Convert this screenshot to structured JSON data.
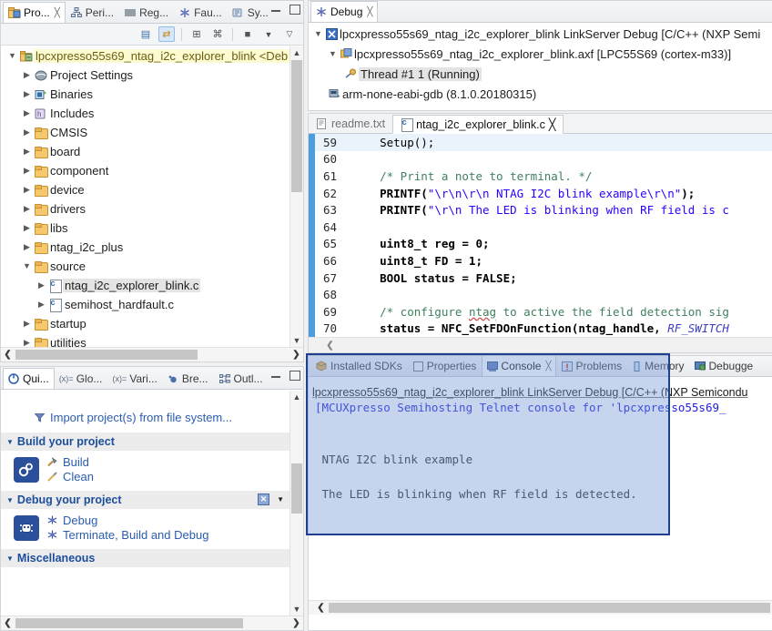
{
  "project_explorer": {
    "tabs": [
      {
        "label": "Pro...",
        "icon": "project-explorer-icon",
        "active": true,
        "closeable": true
      },
      {
        "label": "Peri...",
        "icon": "peripherals-icon",
        "active": false
      },
      {
        "label": "Reg...",
        "icon": "registers-icon",
        "active": false
      },
      {
        "label": "Fau...",
        "icon": "faults-icon",
        "active": false
      },
      {
        "label": "Sy...",
        "icon": "symbol-viewer-icon",
        "active": false
      }
    ],
    "toolbar": [
      {
        "name": "collapse-all-icon",
        "glyph": "▤",
        "selected": false
      },
      {
        "name": "link-with-editor-icon",
        "glyph": "⇄",
        "selected": true
      },
      {
        "name": "view-menu-grid-icon",
        "glyph": "⊞",
        "selected": false
      },
      {
        "name": "filters-icon",
        "glyph": "⌘",
        "selected": false
      },
      {
        "name": "focus-active-task-icon",
        "glyph": "■",
        "selected": false
      },
      {
        "name": "view-dropdown-icon",
        "glyph": "▼",
        "selected": false
      },
      {
        "name": "view-menu-icon",
        "glyph": "▽",
        "selected": false
      }
    ],
    "tree": [
      {
        "label": "lpcxpresso55s69_ntag_i2c_explorer_blink <Deb",
        "indent": 0,
        "arrow": "down",
        "icon": "project-icon",
        "highlight": "yellow"
      },
      {
        "label": "Project Settings",
        "indent": 1,
        "arrow": "right",
        "icon": "settings-icon",
        "highlight": "none"
      },
      {
        "label": "Binaries",
        "indent": 1,
        "arrow": "right",
        "icon": "binaries-icon",
        "highlight": "none"
      },
      {
        "label": "Includes",
        "indent": 1,
        "arrow": "right",
        "icon": "includes-icon",
        "highlight": "none"
      },
      {
        "label": "CMSIS",
        "indent": 1,
        "arrow": "right",
        "icon": "folder-icon",
        "highlight": "none"
      },
      {
        "label": "board",
        "indent": 1,
        "arrow": "right",
        "icon": "folder-icon",
        "highlight": "none"
      },
      {
        "label": "component",
        "indent": 1,
        "arrow": "right",
        "icon": "folder-icon",
        "highlight": "none"
      },
      {
        "label": "device",
        "indent": 1,
        "arrow": "right",
        "icon": "folder-icon",
        "highlight": "none"
      },
      {
        "label": "drivers",
        "indent": 1,
        "arrow": "right",
        "icon": "folder-icon",
        "highlight": "none"
      },
      {
        "label": "libs",
        "indent": 1,
        "arrow": "right",
        "icon": "folder-icon",
        "highlight": "none"
      },
      {
        "label": "ntag_i2c_plus",
        "indent": 1,
        "arrow": "right",
        "icon": "folder-icon",
        "highlight": "none"
      },
      {
        "label": "source",
        "indent": 1,
        "arrow": "down",
        "icon": "folder-icon",
        "highlight": "none"
      },
      {
        "label": "ntag_i2c_explorer_blink.c",
        "indent": 2,
        "arrow": "right",
        "icon": "c-file-icon",
        "highlight": "gray"
      },
      {
        "label": "semihost_hardfault.c",
        "indent": 2,
        "arrow": "right",
        "icon": "c-file-icon",
        "highlight": "none"
      },
      {
        "label": "startup",
        "indent": 1,
        "arrow": "right",
        "icon": "folder-icon",
        "highlight": "none"
      },
      {
        "label": "utilities",
        "indent": 1,
        "arrow": "right",
        "icon": "folder-icon",
        "highlight": "none"
      }
    ]
  },
  "quickstart": {
    "tabs": [
      {
        "label": "Qui...",
        "icon": "quickstart-power-icon",
        "active": true
      },
      {
        "label": "Glo...",
        "icon": "global-variables-icon",
        "active": false
      },
      {
        "label": "Vari...",
        "icon": "variables-icon",
        "active": false
      },
      {
        "label": "Bre...",
        "icon": "breakpoints-icon",
        "active": false
      },
      {
        "label": "Outl...",
        "icon": "outline-icon",
        "active": false
      }
    ],
    "import_link": "Import project(s) from file system...",
    "sections": [
      {
        "title": "Build your project",
        "icon": "build-gears-icon",
        "has_close": false,
        "items": [
          {
            "label": "Build",
            "icon": "hammer-icon"
          },
          {
            "label": "Clean",
            "icon": "brush-icon"
          }
        ]
      },
      {
        "title": "Debug your project",
        "icon": "debug-bug-icon",
        "has_close": true,
        "items": [
          {
            "label": "Debug",
            "icon": "bug-icon"
          },
          {
            "label": "Terminate, Build and Debug",
            "icon": "bug-icon"
          }
        ]
      },
      {
        "title": "Miscellaneous",
        "icon": "",
        "has_close": false,
        "items": []
      }
    ]
  },
  "debug_view": {
    "tab": {
      "label": "Debug",
      "icon": "debug-icon",
      "closeable": true
    },
    "tree": [
      {
        "label": "lpcxpresso55s69_ntag_i2c_explorer_blink LinkServer Debug [C/C++ (NXP Semi",
        "indent": 0,
        "arrow": "down",
        "icon": "launch-config-icon",
        "highlight": false
      },
      {
        "label": "lpcxpresso55s69_ntag_i2c_explorer_blink.axf [LPC55S69 (cortex-m33)]",
        "indent": 1,
        "arrow": "down",
        "icon": "process-icon",
        "highlight": false
      },
      {
        "label": "Thread #1 1 (Running)",
        "indent": 2,
        "arrow": "none",
        "icon": "thread-icon",
        "highlight": true
      },
      {
        "label": "arm-none-eabi-gdb (8.1.0.20180315)",
        "indent": 1,
        "arrow": "none",
        "icon": "gdb-icon",
        "highlight": false
      }
    ]
  },
  "editor": {
    "tabs": [
      {
        "label": "readme.txt",
        "icon": "text-file-icon",
        "active": false,
        "closeable": false
      },
      {
        "label": "ntag_i2c_explorer_blink.c",
        "icon": "c-file-icon",
        "active": true,
        "closeable": true
      }
    ],
    "first_line_number": 59,
    "current_line": 59,
    "lines": [
      {
        "n": 59,
        "segments": [
          {
            "t": "    ",
            "c": "k-pl"
          },
          {
            "t": "Setup();",
            "c": "k-pl"
          }
        ]
      },
      {
        "n": 60,
        "segments": []
      },
      {
        "n": 61,
        "segments": [
          {
            "t": "    ",
            "c": "k-pl"
          },
          {
            "t": "/* Print a note to terminal. */",
            "c": "k-cm"
          }
        ]
      },
      {
        "n": 62,
        "segments": [
          {
            "t": "    ",
            "c": "k-pl"
          },
          {
            "t": "PRINTF(",
            "c": "k-fn"
          },
          {
            "t": "\"\\r\\n\\r\\n NTAG I2C blink example\\r\\n\"",
            "c": "k-st"
          },
          {
            "t": ");",
            "c": "k-fn"
          }
        ]
      },
      {
        "n": 63,
        "segments": [
          {
            "t": "    ",
            "c": "k-pl"
          },
          {
            "t": "PRINTF(",
            "c": "k-fn"
          },
          {
            "t": "\"\\r\\n The LED is blinking when RF field is c",
            "c": "k-st"
          }
        ]
      },
      {
        "n": 64,
        "segments": []
      },
      {
        "n": 65,
        "segments": [
          {
            "t": "    ",
            "c": "k-pl"
          },
          {
            "t": "uint8_t reg = 0;",
            "c": "k-fn"
          }
        ]
      },
      {
        "n": 66,
        "segments": [
          {
            "t": "    ",
            "c": "k-pl"
          },
          {
            "t": "uint8_t FD = 1;",
            "c": "k-fn"
          }
        ]
      },
      {
        "n": 67,
        "segments": [
          {
            "t": "    ",
            "c": "k-pl"
          },
          {
            "t": "BOOL status = FALSE;",
            "c": "k-fn"
          }
        ]
      },
      {
        "n": 68,
        "segments": []
      },
      {
        "n": 69,
        "segments": [
          {
            "t": "    ",
            "c": "k-pl"
          },
          {
            "t": "/* configure ",
            "c": "k-cm"
          },
          {
            "t": "ntag",
            "c": "k-cm k-ul"
          },
          {
            "t": " to active the field detection sig",
            "c": "k-cm"
          }
        ]
      },
      {
        "n": 70,
        "segments": [
          {
            "t": "    ",
            "c": "k-pl"
          },
          {
            "t": "status = NFC_SetFDOnFunction(ntag_handle, ",
            "c": "k-fn"
          },
          {
            "t": "RF_SWITCH",
            "c": "k-it"
          }
        ]
      }
    ]
  },
  "console": {
    "tabs": [
      {
        "label": "Installed SDKs",
        "icon": "sdk-package-icon",
        "active": false
      },
      {
        "label": "Properties",
        "icon": "properties-icon",
        "active": false
      },
      {
        "label": "Console",
        "icon": "console-icon",
        "active": true,
        "closeable": true
      },
      {
        "label": "Problems",
        "icon": "problems-icon",
        "active": false
      },
      {
        "label": "Memory",
        "icon": "memory-icon",
        "active": false
      },
      {
        "label": "Debugge",
        "icon": "debugger-console-icon",
        "active": false
      }
    ],
    "title": "lpcxpresso55s69_ntag_i2c_explorer_blink LinkServer Debug [C/C++ (NXP Semicondu",
    "lines": [
      {
        "text": "[MCUXpresso Semihosting Telnet console for 'lpcxpresso55s69_",
        "blue": true
      },
      {
        "text": "",
        "blue": false
      },
      {
        "text": "",
        "blue": false
      },
      {
        "text": " NTAG I2C blink example",
        "blue": false
      },
      {
        "text": "",
        "blue": false
      },
      {
        "text": " The LED is blinking when RF field is detected.",
        "blue": false
      }
    ],
    "highlight_color": "#1f3f8f"
  }
}
